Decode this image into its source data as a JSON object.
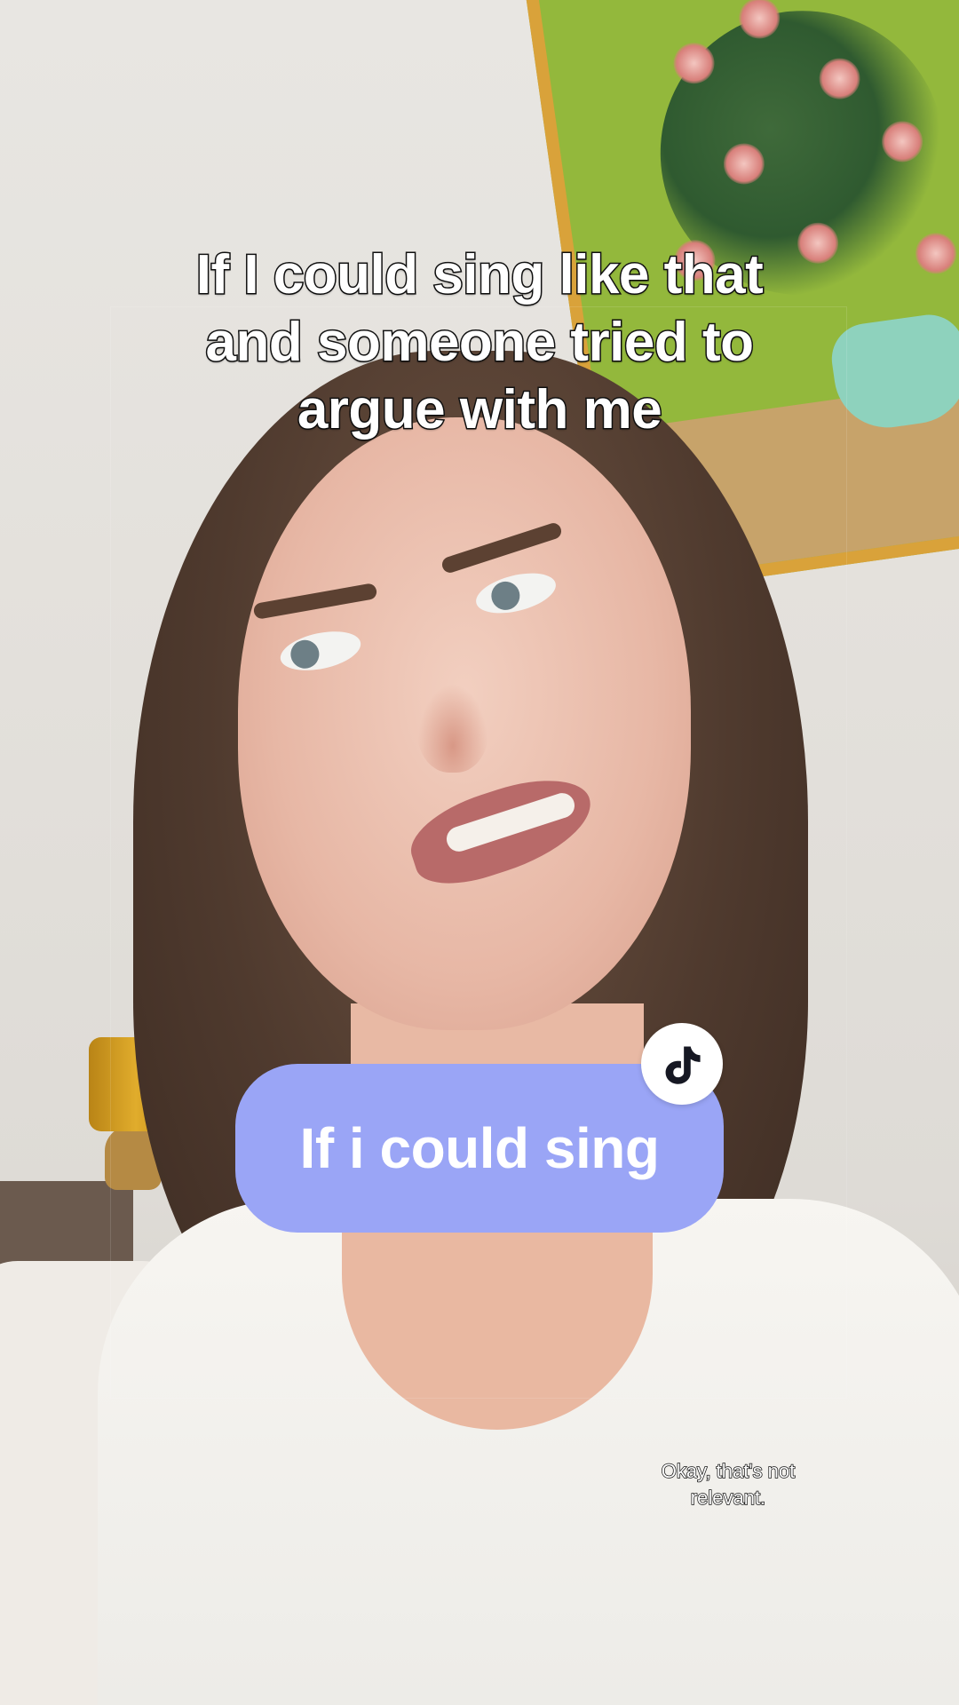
{
  "overlay": {
    "caption_lines": [
      "If I could sing like that",
      "and someone tried to",
      "argue with me"
    ],
    "sticker_label": "If i could sing",
    "subtitle_lines": [
      "Okay, that's not",
      "relevant."
    ]
  },
  "icons": {
    "sticker_badge": "music-note-icon"
  },
  "colors": {
    "sticker_background": "#9aa5f6",
    "sticker_text": "#ffffff",
    "badge_background": "#ffffff",
    "caption_text": "#ffffff",
    "caption_stroke": "#111111"
  }
}
